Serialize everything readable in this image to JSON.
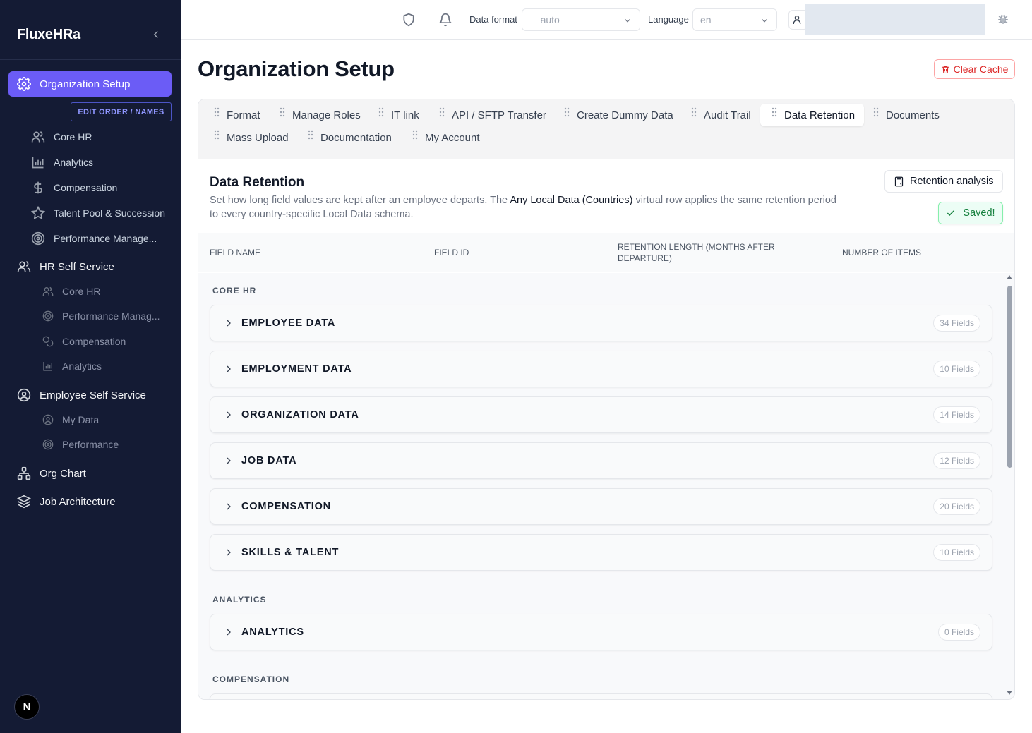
{
  "brand": "FluxeHRa",
  "colors": {
    "sidebar_bg": "#141b34",
    "accent": "#6b5cf6",
    "danger": "#dc2626",
    "success": "#15803d"
  },
  "sidebar": {
    "active_item": "Organization Setup",
    "edit_order": "EDIT ORDER / NAMES",
    "org_setup_children": [
      {
        "label": "Core HR",
        "icon": "users-icon"
      },
      {
        "label": "Analytics",
        "icon": "bar-chart-icon"
      },
      {
        "label": "Compensation",
        "icon": "dollar-icon"
      },
      {
        "label": "Talent Pool & Succession",
        "icon": "star-icon"
      },
      {
        "label": "Performance Manage...",
        "icon": "target-icon"
      }
    ],
    "hr_self_service": {
      "label": "HR Self Service",
      "children": [
        {
          "label": "Core HR",
          "icon": "users-icon"
        },
        {
          "label": "Performance Manag...",
          "icon": "target-icon"
        },
        {
          "label": "Compensation",
          "icon": "coins-icon"
        },
        {
          "label": "Analytics",
          "icon": "bar-chart-icon"
        }
      ]
    },
    "employee_self_service": {
      "label": "Employee Self Service",
      "children": [
        {
          "label": "My Data",
          "icon": "user-circle-icon"
        },
        {
          "label": "Performance",
          "icon": "target-icon"
        }
      ]
    },
    "org_chart": "Org Chart",
    "job_architecture": "Job Architecture",
    "badge": "N"
  },
  "topbar": {
    "data_format_label": "Data format",
    "data_format_value": "__auto__",
    "language_label": "Language",
    "language_value": "en"
  },
  "page": {
    "title": "Organization Setup",
    "clear_cache": "Clear Cache"
  },
  "tabs": [
    "Format",
    "Manage Roles",
    "IT link",
    "API / SFTP Transfer",
    "Create Dummy Data",
    "Audit Trail",
    "Data Retention",
    "Documents",
    "Mass Upload",
    "Documentation",
    "My Account"
  ],
  "active_tab": "Data Retention",
  "section": {
    "title": "Data Retention",
    "desc_before": "Set how long field values are kept after an employee departs. The ",
    "desc_strong": "Any Local Data (Countries)",
    "desc_after": " virtual row applies the same retention period to every country-specific Local Data schema.",
    "retention_button": "Retention analysis",
    "saved": "Saved!"
  },
  "table": {
    "columns": [
      "FIELD NAME",
      "FIELD ID",
      "RETENTION LENGTH (MONTHS AFTER DEPARTURE)",
      "NUMBER OF ITEMS"
    ],
    "groups": [
      {
        "label": "CORE HR",
        "rows": [
          {
            "name": "EMPLOYEE DATA",
            "count": "34 Fields"
          },
          {
            "name": "EMPLOYMENT DATA",
            "count": "10 Fields"
          },
          {
            "name": "ORGANIZATION DATA",
            "count": "14 Fields"
          },
          {
            "name": "JOB DATA",
            "count": "12 Fields"
          },
          {
            "name": "COMPENSATION",
            "count": "20 Fields"
          },
          {
            "name": "SKILLS & TALENT",
            "count": "10 Fields"
          }
        ]
      },
      {
        "label": "ANALYTICS",
        "rows": [
          {
            "name": "ANALYTICS",
            "count": "0 Fields"
          }
        ]
      },
      {
        "label": "COMPENSATION",
        "rows": []
      }
    ]
  }
}
